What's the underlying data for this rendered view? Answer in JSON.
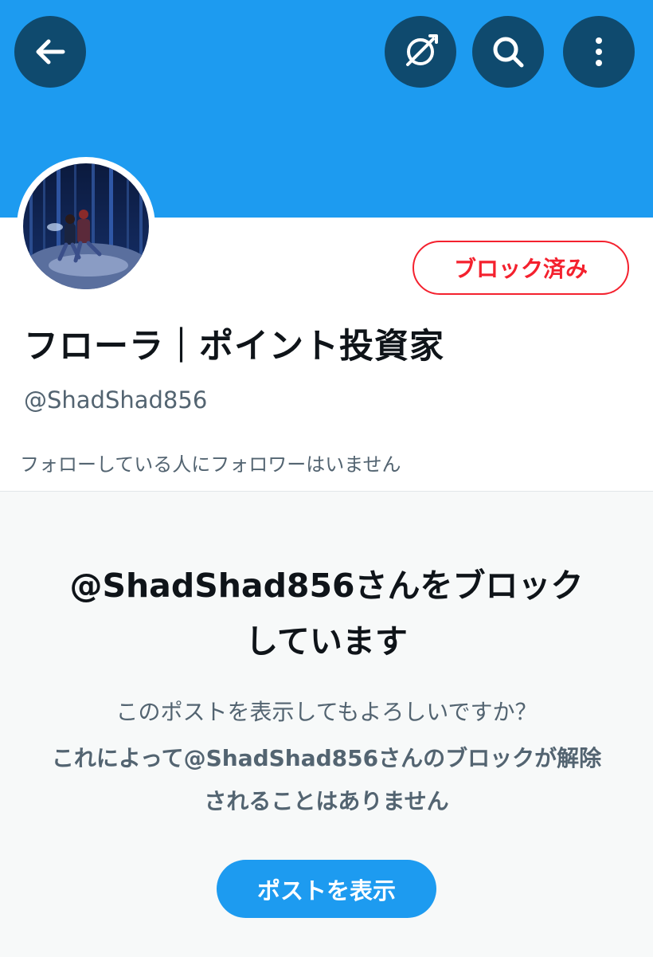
{
  "header": {
    "back_icon": "arrow-left-icon",
    "vpn_icon": "globe-slash-icon",
    "search_icon": "search-icon",
    "more_icon": "more-vertical-icon",
    "banner_color": "#1d9bf0",
    "button_color": "#0f4a6e"
  },
  "profile": {
    "blocked_label": "ブロック済み",
    "display_name": "フローラ｜ポイント投資家",
    "handle": "@ShadShad856",
    "followers_note": "フォローしている人にフォロワーはいません"
  },
  "blocked_notice": {
    "title": "@ShadShad856さんをブロックしています",
    "question": "このポストを表示してもよろしいですか？",
    "note": "これによって@ShadShad856さんのブロックが解除されることはありません",
    "show_button": "ポストを表示"
  },
  "colors": {
    "accent": "#1d9bf0",
    "danger": "#f4212e",
    "text_primary": "#0f1419",
    "text_secondary": "#536471"
  }
}
